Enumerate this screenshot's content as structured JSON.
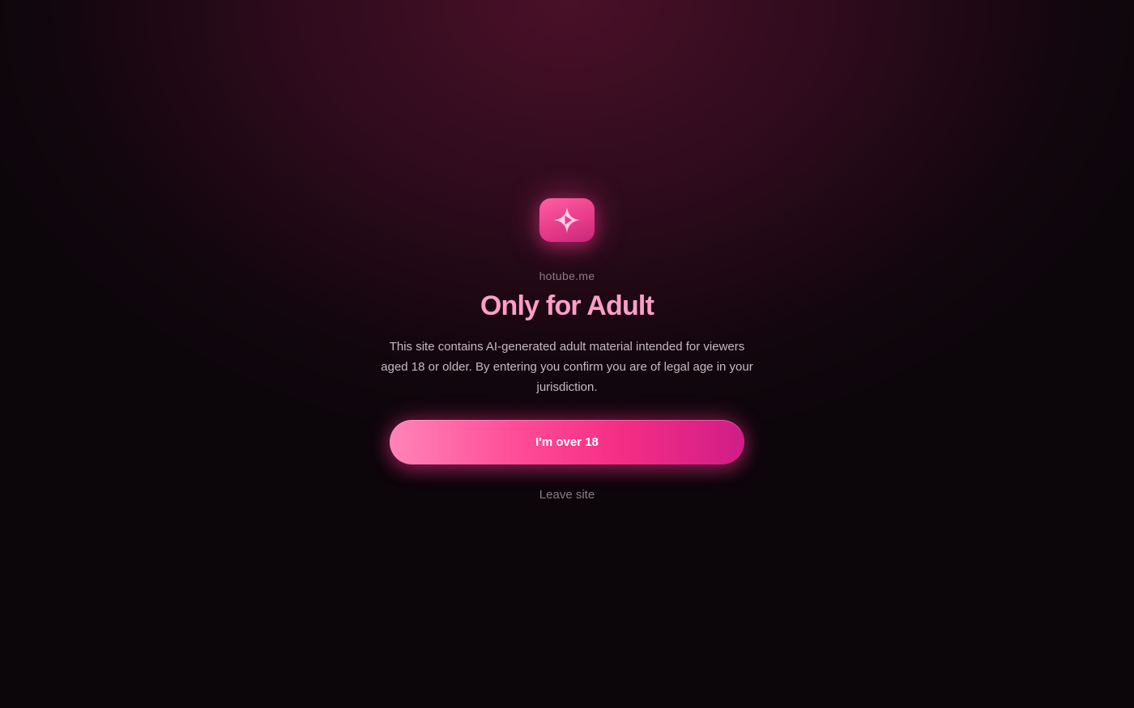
{
  "brand": {
    "logo_icon": "sparkle-play-icon",
    "site_name": "hotube.me"
  },
  "gate": {
    "title": "Only for Adult",
    "description": "This site contains AI-generated adult material intended for viewers aged 18 or older. By entering you confirm you are of legal age in your jurisdiction.",
    "confirm_label": "I'm over 18",
    "leave_label": "Leave site"
  },
  "colors": {
    "accent": "#ff4d98",
    "title": "#ff9ec8",
    "background": "#0c060b"
  }
}
